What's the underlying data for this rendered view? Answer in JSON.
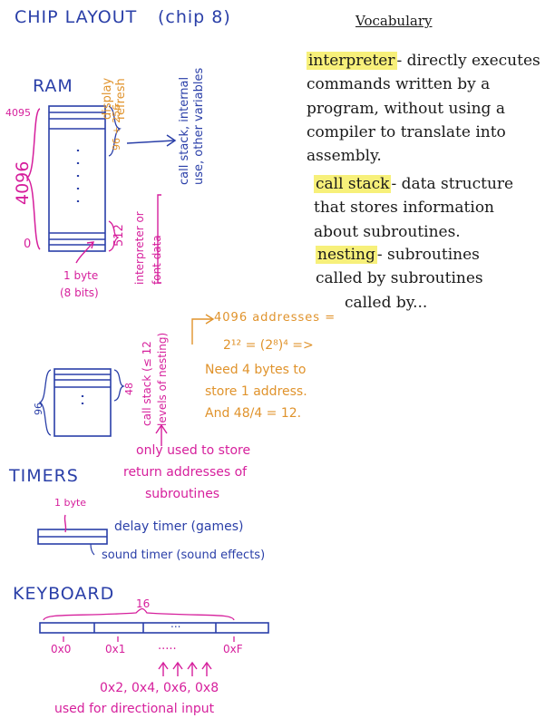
{
  "title": "CHIP LAYOUT",
  "subtitle": "(chip 8)",
  "ram": {
    "heading": "RAM",
    "addr_top": "4095",
    "addr_bottom": "0",
    "size": "4096",
    "upper_range": "96 + 256",
    "display_label": "display refresh",
    "internal_label": "call stack, internal use, other variables",
    "lower_range": "512",
    "interp_label": "interpreter or font data",
    "byte_label": "1 byte",
    "bits_label": "(8 bits)"
  },
  "stack": {
    "height_label": "96",
    "range_label": "48",
    "label": "call stack (≤ 12 levels of nesting)",
    "explain_1": "4096 addresses =",
    "explain_2": "2¹² = (2⁸)⁴ =>",
    "explain_3": "Need 4 bytes to",
    "explain_4": "store 1 address.",
    "explain_5": "And 48/4 = 12.",
    "note_1": "only used to store",
    "note_2": "return addresses of",
    "note_3": "subroutines"
  },
  "timers": {
    "heading": "TIMERS",
    "byte_label": "1 byte",
    "delay": "delay timer (games)",
    "sound": "sound timer (sound effects)"
  },
  "keyboard": {
    "heading": "KEYBOARD",
    "count": "16",
    "dots": "...",
    "k0": "0x0",
    "k1": "0x1",
    "kdots": ".....",
    "kf": "0xF",
    "dir_keys": "0x2, 0x4, 0x6, 0x8",
    "dir_note": "used for directional input"
  },
  "vocabulary": {
    "heading": "Vocabulary",
    "interpreter_term": "interpreter",
    "interpreter_def_1": "- directly executes",
    "interpreter_def_2": "commands written by a",
    "interpreter_def_3": "program, without using a",
    "interpreter_def_4": "compiler to translate into",
    "interpreter_def_5": "assembly.",
    "callstack_term": "call stack",
    "callstack_def_1": "- data structure",
    "callstack_def_2": "that stores information",
    "callstack_def_3": "about subroutines.",
    "nesting_term": "nesting",
    "nesting_def_1": "- subroutines",
    "nesting_def_2": "called by subroutines",
    "nesting_def_3": "called by..."
  },
  "colors": {
    "blue": "#2a3fa8",
    "pink": "#d61f9c",
    "orange": "#e0932c",
    "highlight": "#f7f07a"
  }
}
